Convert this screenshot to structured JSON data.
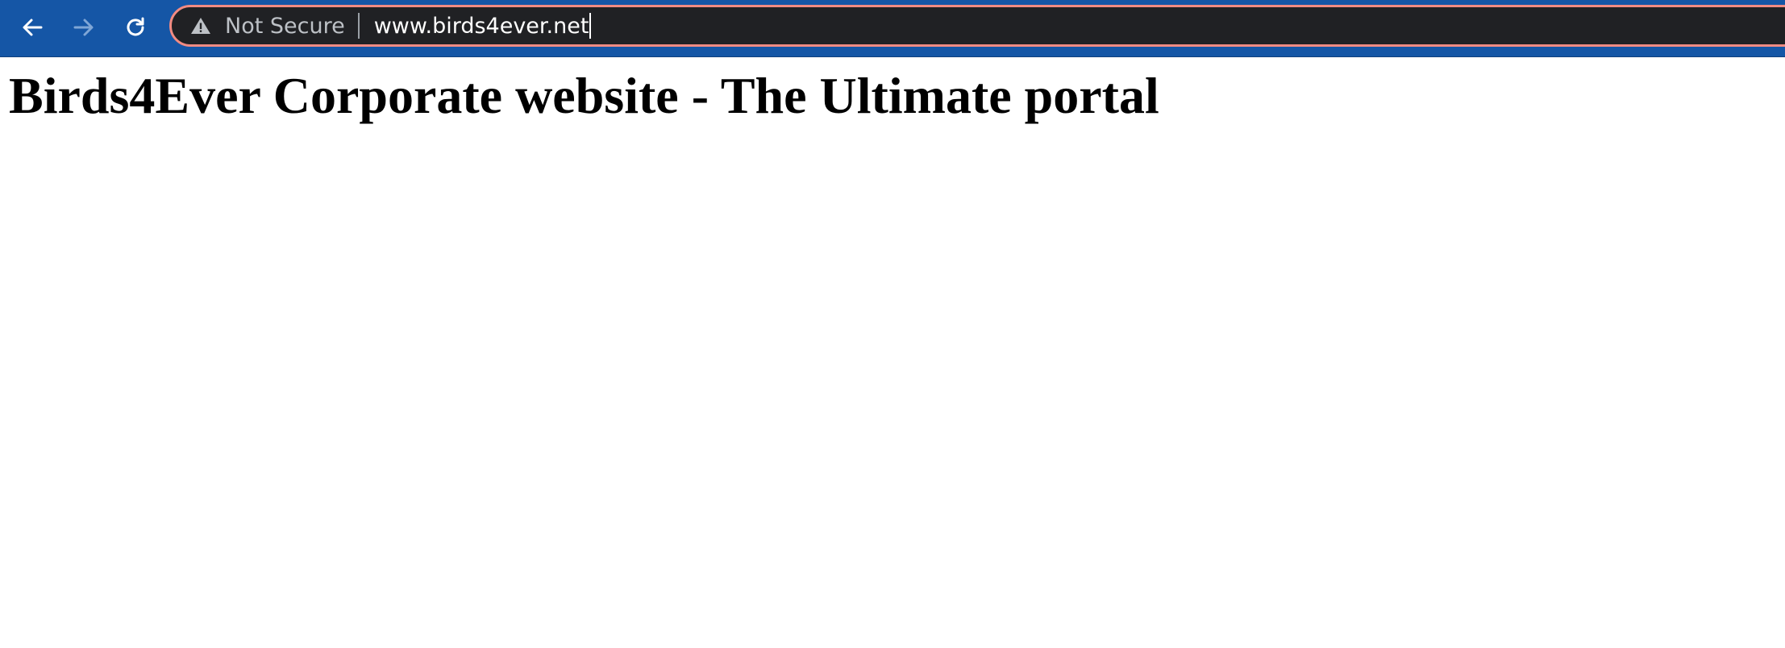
{
  "browser": {
    "theme_color": "#1556a6",
    "address_bar": {
      "security_icon": "warning-triangle-icon",
      "security_label": "Not Secure",
      "url": "www.birds4ever.net",
      "border_color": "#f28b82"
    },
    "nav": {
      "back_icon": "arrow-left-icon",
      "forward_icon": "arrow-right-icon",
      "reload_icon": "reload-icon"
    }
  },
  "page": {
    "heading": "Birds4Ever Corporate website - The Ultimate portal"
  }
}
